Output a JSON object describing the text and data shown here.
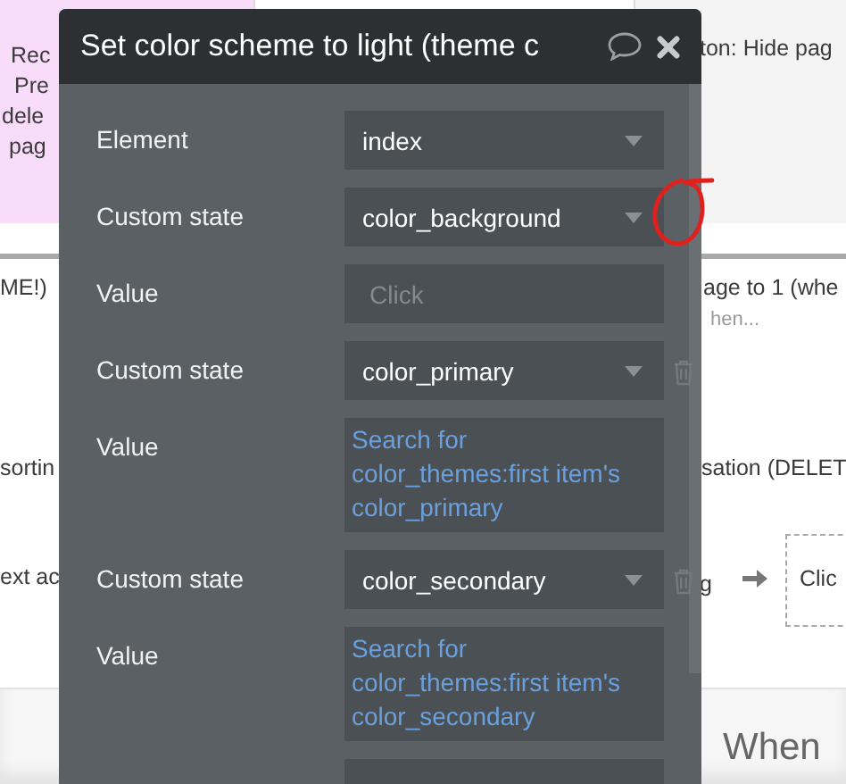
{
  "background": {
    "texts": [
      {
        "kind": "text",
        "text": "Rec"
      },
      {
        "kind": "text",
        "text": "Pre"
      },
      {
        "kind": "text",
        "text": "dele"
      },
      {
        "kind": "text",
        "text": "pag"
      },
      {
        "kind": "text",
        "text": "ton: Hide pag"
      },
      {
        "kind": "text",
        "text": "ME!)"
      },
      {
        "kind": "text",
        "text": "age to 1 (whe"
      },
      {
        "kind": "hint",
        "text": "hen..."
      },
      {
        "kind": "text",
        "text": "sortin"
      },
      {
        "kind": "text",
        "text": "sation (DELET"
      },
      {
        "kind": "text",
        "text": "ext ac"
      },
      {
        "kind": "text",
        "text": "g"
      },
      {
        "kind": "action",
        "text": "Clic"
      },
      {
        "kind": "heading",
        "text": "When"
      }
    ]
  },
  "dialog": {
    "title": "Set color scheme to light (theme c",
    "rows": [
      {
        "label": "Element",
        "kind": "dropdown",
        "value": "index",
        "deletable": false
      },
      {
        "label": "Custom state",
        "kind": "dropdown",
        "value": "color_background",
        "deletable": false
      },
      {
        "label": "Value",
        "kind": "input",
        "placeholder": "Click",
        "deletable": false
      },
      {
        "label": "Custom state",
        "kind": "dropdown",
        "value": "color_primary",
        "deletable": true
      },
      {
        "label": "Value",
        "kind": "expression",
        "value": "Search for color_themes:first item's color_primary",
        "deletable": false
      },
      {
        "label": "Custom state",
        "kind": "dropdown",
        "value": "color_secondary",
        "deletable": true
      },
      {
        "label": "Value",
        "kind": "expression",
        "value": "Search for color_themes:first item's color_secondary",
        "deletable": false
      },
      {
        "kind": "dropdown",
        "deletable": false
      }
    ]
  }
}
